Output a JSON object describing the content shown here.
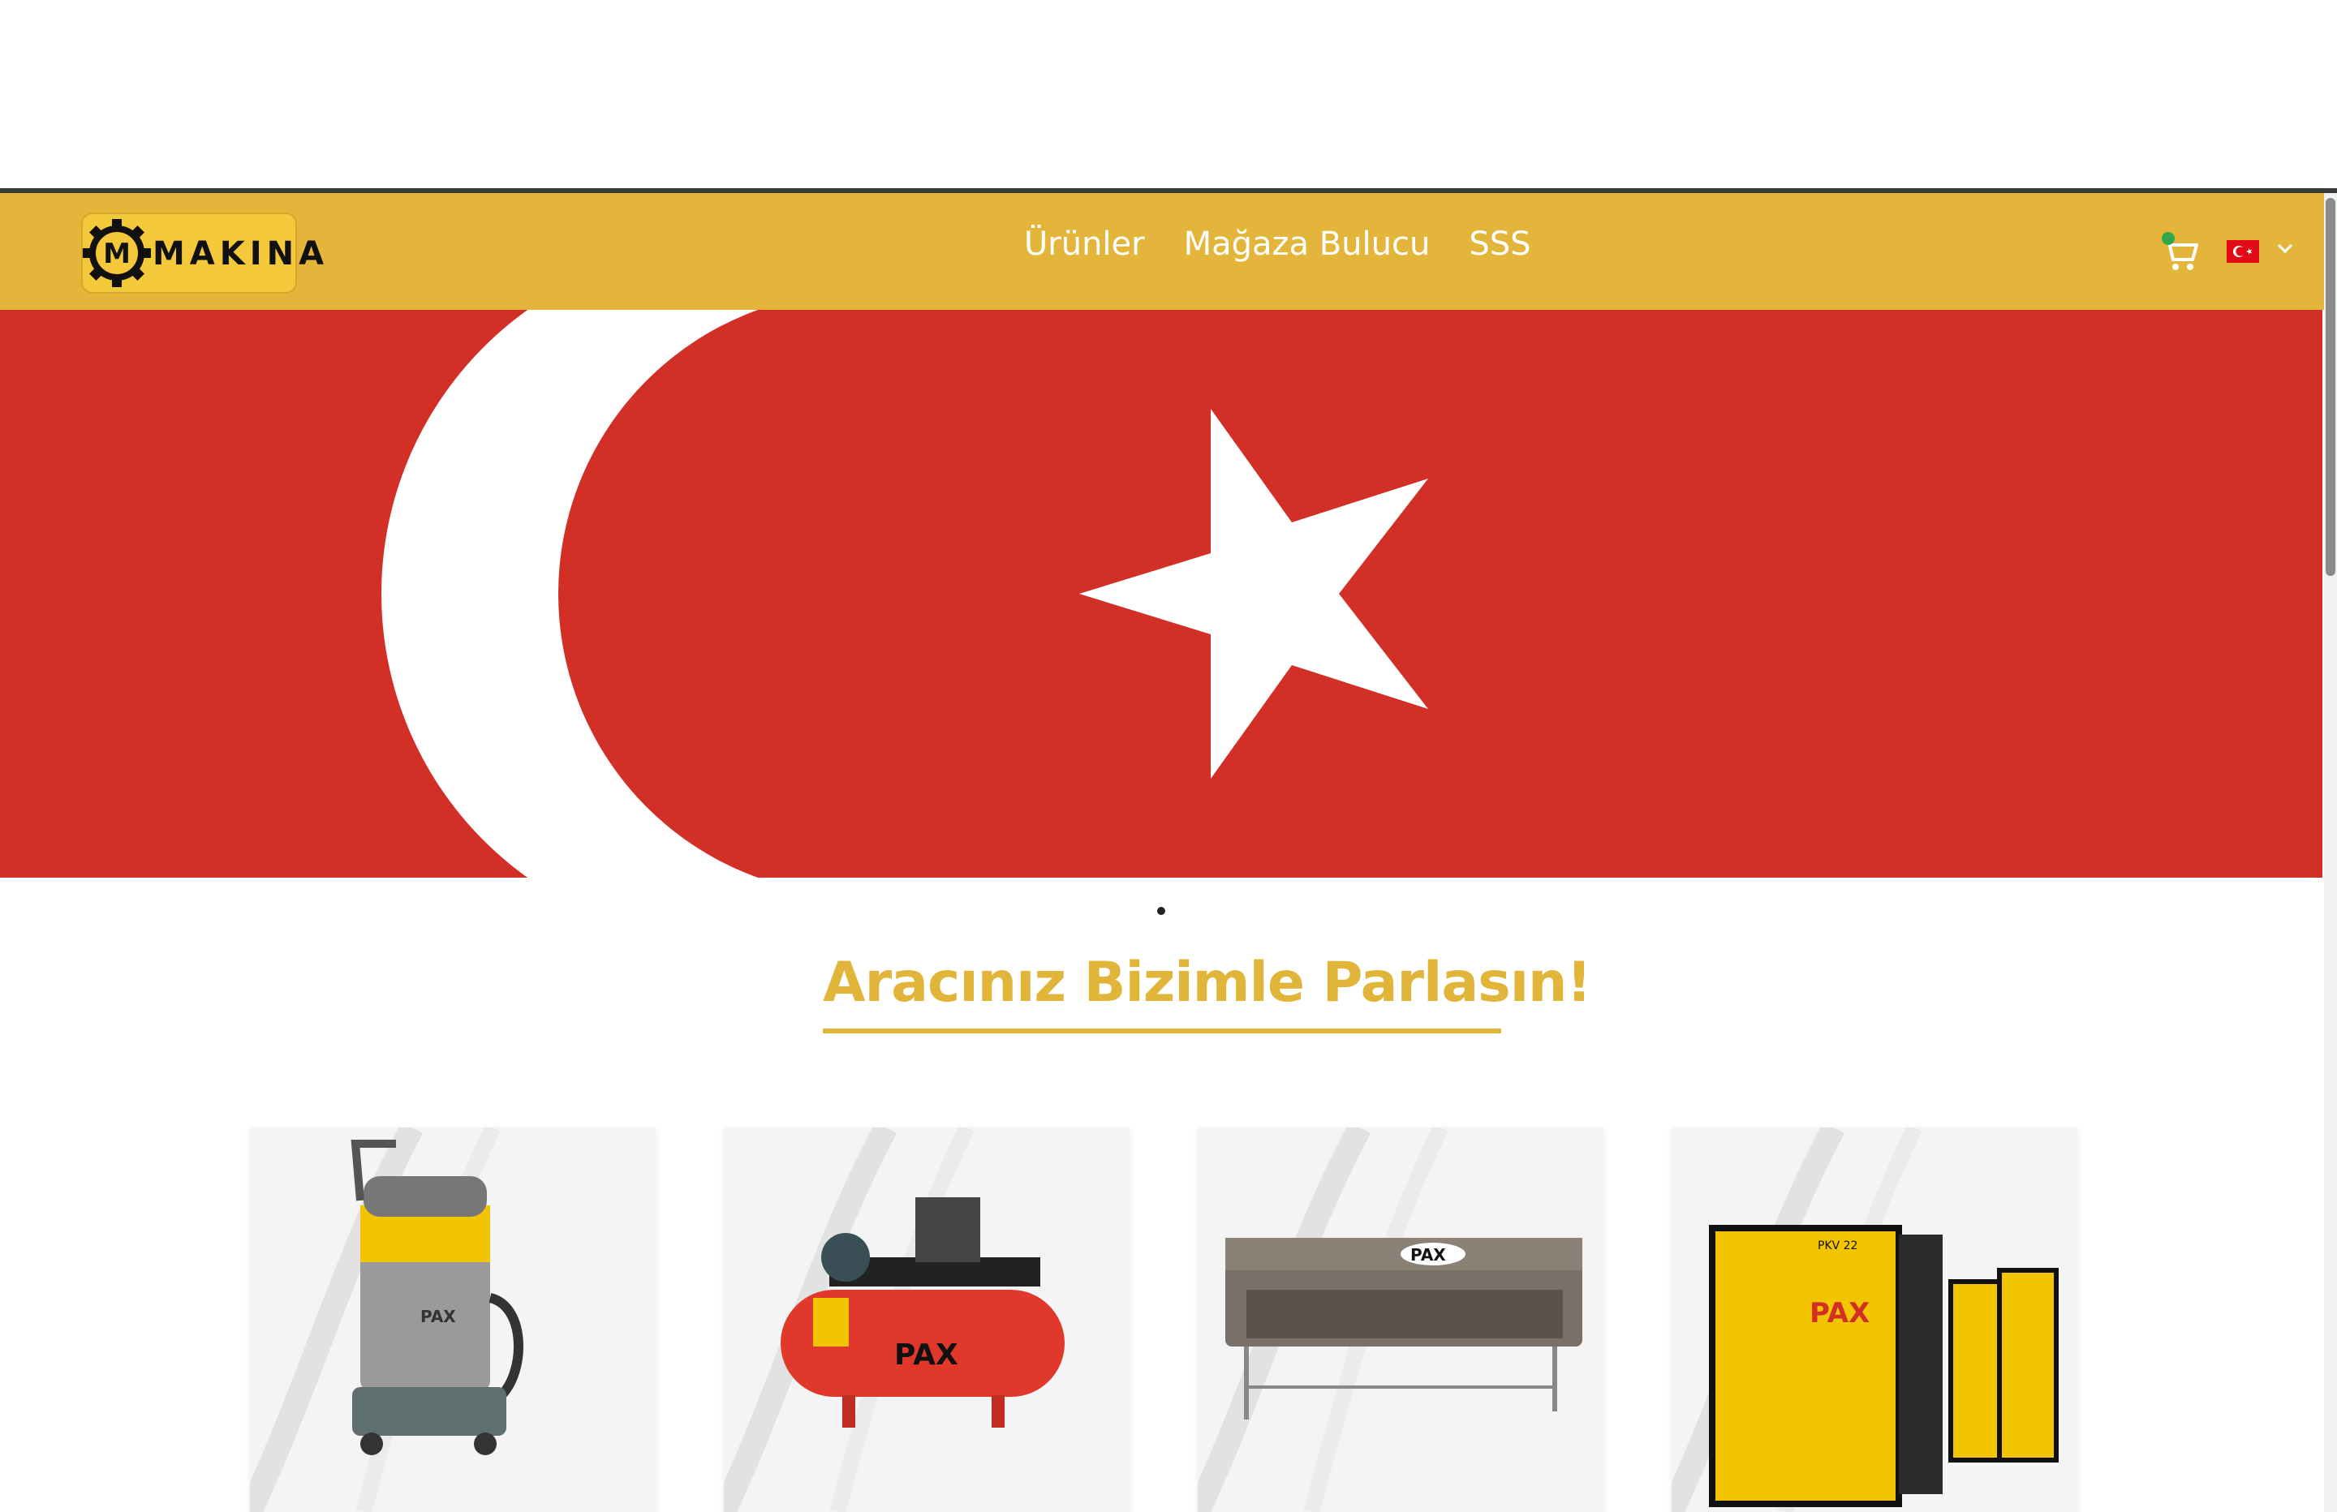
{
  "navbar": {
    "logo_text": "MAKINA",
    "logo_letter": "M",
    "links": [
      "Ürünler",
      "Mağaza Bulucu",
      "SSS"
    ],
    "cart_icon": "cart-icon",
    "language": "tr",
    "colors": {
      "bar": "#e3b63b",
      "link": "#ffffff"
    }
  },
  "hero": {
    "image": "turkish-flag",
    "colors": {
      "flag_red": "#d22f26",
      "flag_white": "#ffffff"
    }
  },
  "carousel": {
    "active_dot": 1
  },
  "headline": {
    "text": "Aracınız Bizimle Parlasın!",
    "color": "#e1b53a"
  },
  "products": [
    {
      "image": "wet-dry-vacuum",
      "brand": "PAX"
    },
    {
      "image": "air-compressor",
      "brand": "PAX"
    },
    {
      "image": "carpet-washing-machine",
      "brand": "PAX"
    },
    {
      "image": "screw-compressor",
      "brand": "PAX",
      "model": "PKV 22"
    }
  ]
}
